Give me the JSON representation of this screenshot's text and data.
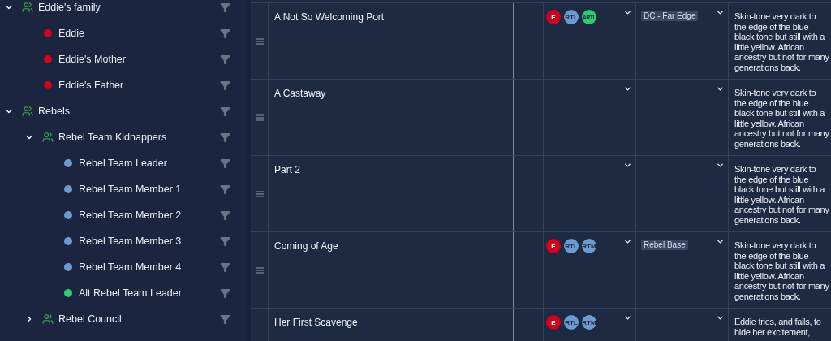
{
  "tree": [
    {
      "label": "Eddie's family",
      "kind": "group",
      "expanded": true,
      "children": [
        {
          "label": "Eddie",
          "kind": "person",
          "color": "#d0021b"
        },
        {
          "label": "Eddie's Mother",
          "kind": "person",
          "color": "#d0021b"
        },
        {
          "label": "Eddie's Father",
          "kind": "person",
          "color": "#d0021b"
        }
      ]
    },
    {
      "label": "Rebels",
      "kind": "group",
      "expanded": true,
      "children": [
        {
          "label": "Rebel Team Kidnappers",
          "kind": "group",
          "expanded": true,
          "children": [
            {
              "label": "Rebel Team Leader",
              "kind": "person",
              "color": "#6c9bd2"
            },
            {
              "label": "Rebel Team Member 1",
              "kind": "person",
              "color": "#6c9bd2"
            },
            {
              "label": "Rebel Team Member 2",
              "kind": "person",
              "color": "#6c9bd2"
            },
            {
              "label": "Rebel Team Member 3",
              "kind": "person",
              "color": "#6c9bd2"
            },
            {
              "label": "Rebel Team Member 4",
              "kind": "person",
              "color": "#6c9bd2"
            },
            {
              "label": "Alt Rebel Team Leader",
              "kind": "person",
              "color": "#2ecc71"
            }
          ]
        },
        {
          "label": "Rebel Council",
          "kind": "group",
          "expanded": false
        }
      ]
    }
  ],
  "rows": [
    {
      "title": "A Not So Welcoming Port",
      "characters": [
        {
          "initials": "E",
          "color": "#d0021b"
        },
        {
          "initials": "RTL",
          "color": "#6c9bd2"
        },
        {
          "initials": "ARTL",
          "color": "#2ecc71"
        }
      ],
      "location": "DC - Far Edge",
      "description": "Skin-tone very dark to the edge of the blue black tone but still with a little yellow. African ancestry but not for many generations back."
    },
    {
      "title": "A Castaway",
      "description": "Skin-tone very dark to the edge of the blue black tone but still with a little yellow. African ancestry but not for many generations back."
    },
    {
      "title": "Part 2",
      "description": "Skin-tone very dark to the edge of the blue black tone but still with a little yellow. African ancestry but not for many generations back."
    },
    {
      "title": "Coming of Age",
      "characters": [
        {
          "initials": "E",
          "color": "#d0021b"
        },
        {
          "initials": "RTL",
          "color": "#6c9bd2"
        },
        {
          "initials": "RTM",
          "color": "#6c9bd2"
        }
      ],
      "location": "Rebel Base",
      "description": "Skin-tone very dark to the edge of the blue black tone but still with a little yellow. African ancestry but not for many generations back."
    },
    {
      "title": "Her First Scavenge",
      "characters": [
        {
          "initials": "E",
          "color": "#d0021b"
        },
        {
          "initials": "RTL",
          "color": "#6c9bd2"
        },
        {
          "initials": "RTM",
          "color": "#6c9bd2"
        }
      ],
      "description": "Eddie tries, and fails, to hide her excitement,"
    }
  ]
}
